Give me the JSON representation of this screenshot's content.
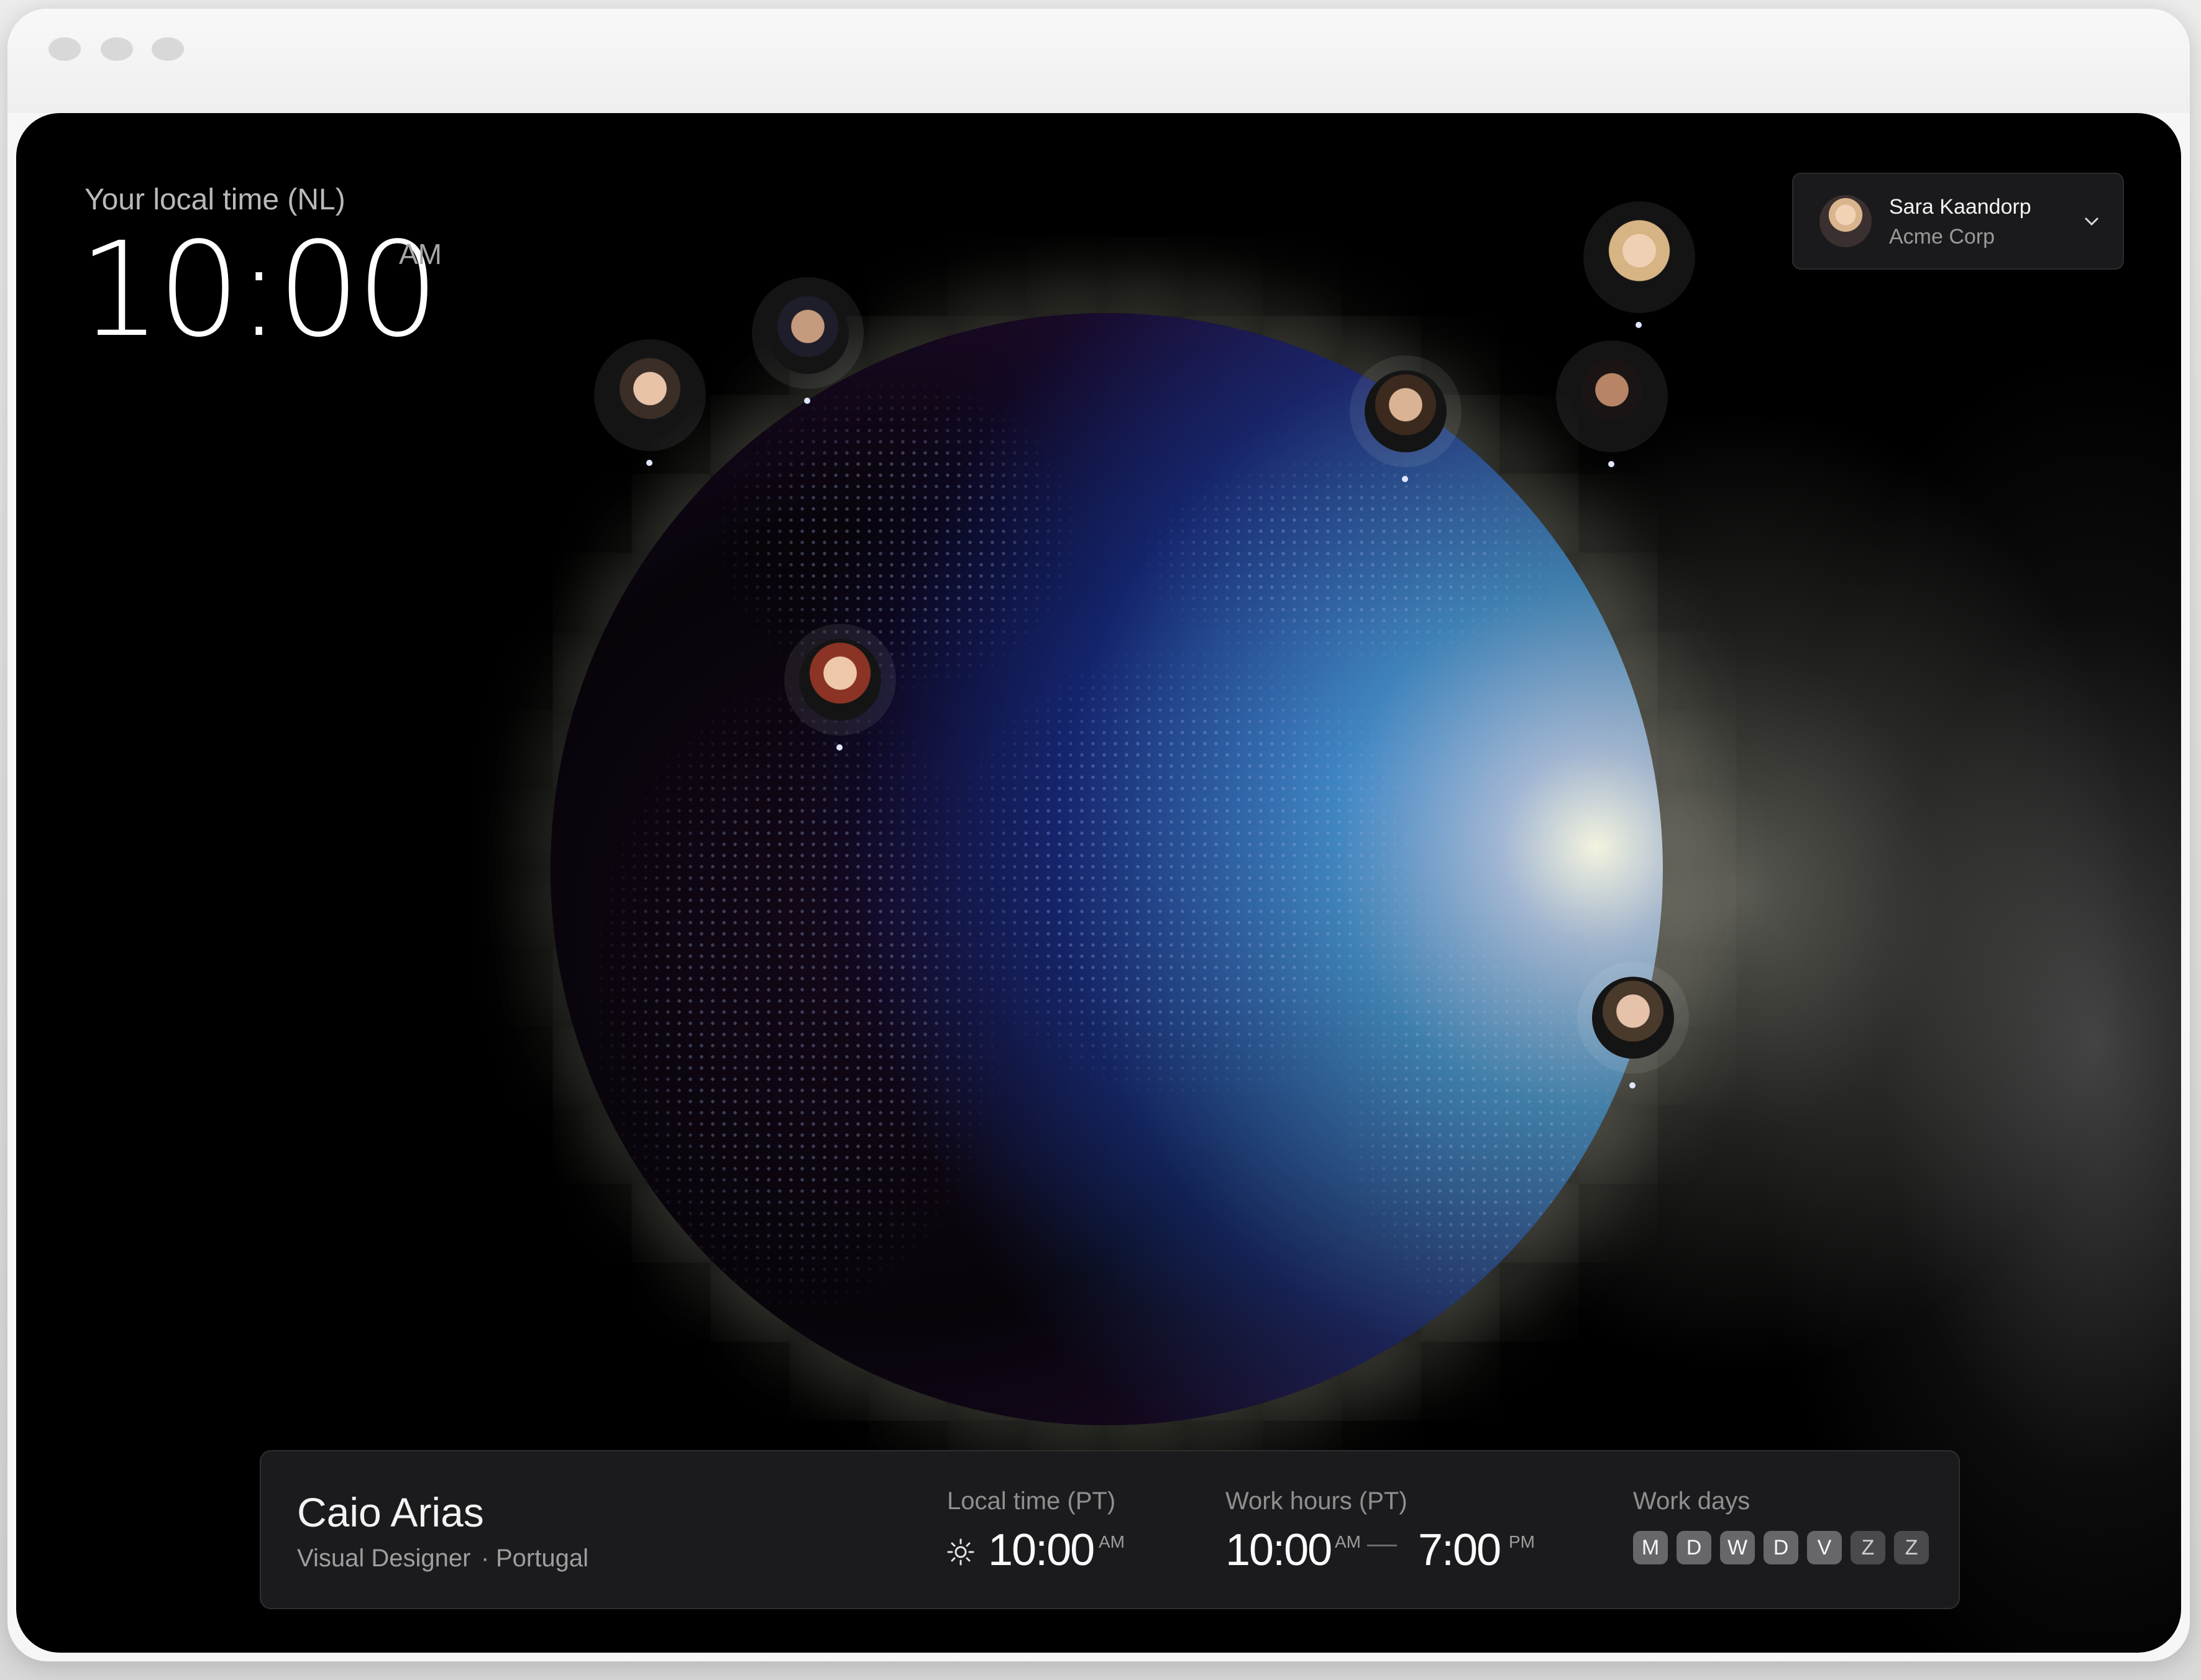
{
  "header": {
    "local_label": "Your local time (NL)",
    "local_time": "10:00",
    "local_ampm": "AM"
  },
  "account": {
    "name": "Sara Kaandorp",
    "org": "Acme Corp"
  },
  "team_members_on_globe": 7,
  "selected_member": {
    "name": "Caio Arias",
    "role": "Visual Designer",
    "separator": "·",
    "country": "Portugal",
    "local_time_label": "Local time (PT)",
    "local_time": "10:00",
    "local_time_suffix": "AM",
    "work_hours_label": "Work hours (PT)",
    "work_start": "10:00",
    "work_start_suffix": "AM",
    "work_end": "7:00",
    "work_end_suffix": "PM",
    "work_days_label": "Work days",
    "work_days": [
      "M",
      "D",
      "W",
      "D",
      "V",
      "Z",
      "Z"
    ]
  },
  "colors": {
    "background": "#000000",
    "panel": "#1b1b1e",
    "day_active": "#66666b",
    "day_off": "#4a4a4e"
  }
}
